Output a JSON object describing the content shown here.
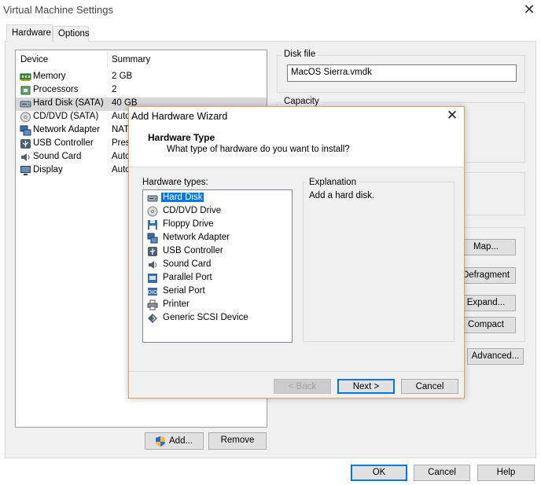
{
  "window": {
    "title": "Virtual Machine Settings",
    "close_symbol": "✕"
  },
  "tabs": [
    {
      "label": "Hardware"
    },
    {
      "label": "Options"
    }
  ],
  "device_table": {
    "headers": {
      "device": "Device",
      "summary": "Summary"
    },
    "rows": [
      {
        "name": "Memory",
        "summary": "2 GB",
        "icon": "memory-icon"
      },
      {
        "name": "Processors",
        "summary": "2",
        "icon": "processor-icon"
      },
      {
        "name": "Hard Disk (SATA)",
        "summary": "40 GB",
        "icon": "hard-disk-icon"
      },
      {
        "name": "CD/DVD (SATA)",
        "summary": "Auto",
        "icon": "cd-dvd-icon"
      },
      {
        "name": "Network Adapter",
        "summary": "NAT",
        "icon": "network-adapter-icon"
      },
      {
        "name": "USB Controller",
        "summary": "Pres",
        "icon": "usb-icon"
      },
      {
        "name": "Sound Card",
        "summary": "Auto",
        "icon": "sound-card-icon"
      },
      {
        "name": "Display",
        "summary": "Auto",
        "icon": "display-icon"
      }
    ],
    "selected_index": 2
  },
  "left_buttons": {
    "add": "Add...",
    "remove": "Remove"
  },
  "disk_file": {
    "label": "Disk file",
    "value": "MacOS Sierra.vmdk"
  },
  "capacity": {
    "label": "Capacity"
  },
  "right_buttons": {
    "map": "Map...",
    "defragment": "Defragment",
    "expand": "Expand...",
    "compact": "Compact",
    "advanced": "Advanced..."
  },
  "bottom_buttons": {
    "ok": "OK",
    "cancel": "Cancel",
    "help": "Help"
  },
  "dialog": {
    "title": "Add Hardware Wizard",
    "close_symbol": "✕",
    "heading": "Hardware Type",
    "subheading": "What type of hardware do you want to install?",
    "hardware_types_label": "Hardware types:",
    "hardware_types": [
      {
        "label": "Hard Disk",
        "icon": "hard-disk-icon"
      },
      {
        "label": "CD/DVD Drive",
        "icon": "cd-dvd-icon"
      },
      {
        "label": "Floppy Drive",
        "icon": "floppy-icon"
      },
      {
        "label": "Network Adapter",
        "icon": "network-adapter-icon"
      },
      {
        "label": "USB Controller",
        "icon": "usb-icon"
      },
      {
        "label": "Sound Card",
        "icon": "sound-card-icon"
      },
      {
        "label": "Parallel Port",
        "icon": "parallel-port-icon"
      },
      {
        "label": "Serial Port",
        "icon": "serial-port-icon"
      },
      {
        "label": "Printer",
        "icon": "printer-icon"
      },
      {
        "label": "Generic SCSI Device",
        "icon": "scsi-icon"
      }
    ],
    "selected_index": 0,
    "explanation_label": "Explanation",
    "explanation_text": "Add a hard disk.",
    "buttons": {
      "back": "< Back",
      "next": "Next >",
      "cancel": "Cancel"
    }
  }
}
